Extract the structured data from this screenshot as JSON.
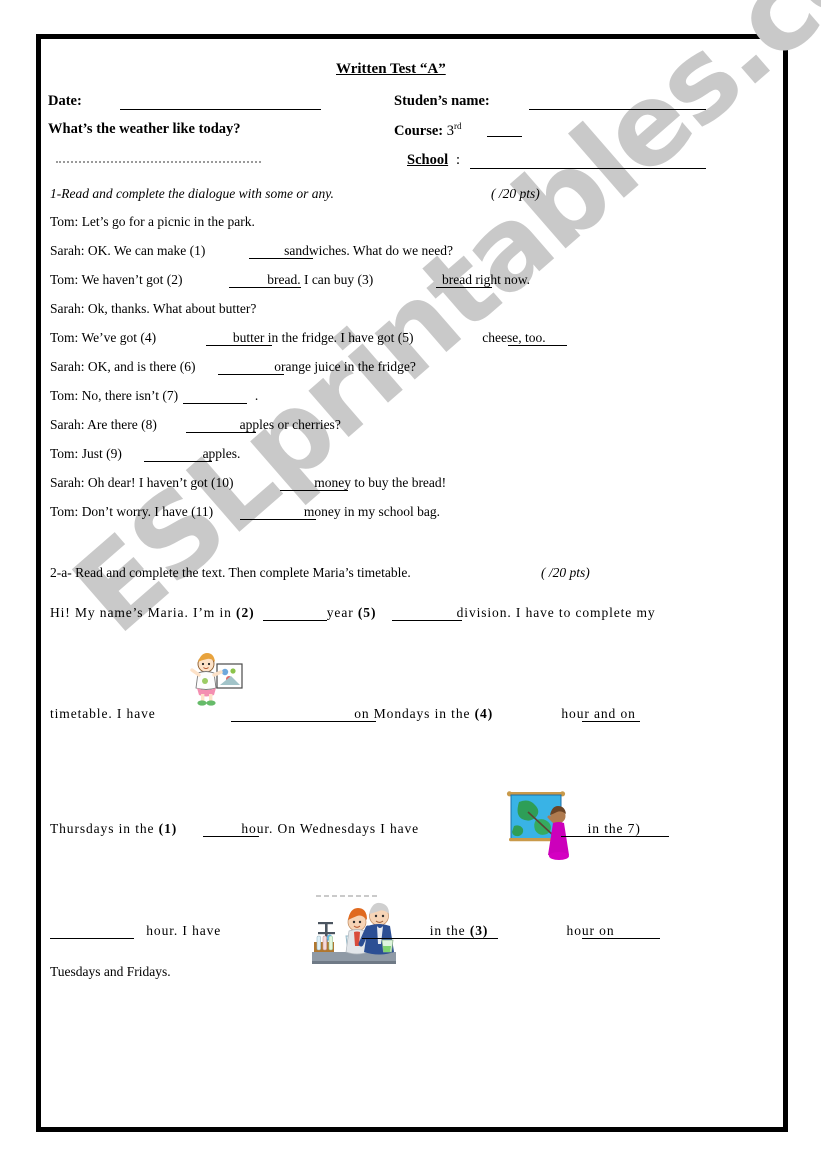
{
  "document": {
    "title": "Written Test “A”",
    "watermark": "ESLprintables.com"
  },
  "header": {
    "date_label": "Date:",
    "weather_question": "What’s the weather like today?",
    "student_name_label": "Studen’s name:",
    "course_label": "Course:",
    "course_value": "3",
    "course_ordinal": "rd",
    "school_label": "School",
    "school_colon": ":"
  },
  "exercise1": {
    "instruction": "1-Read and complete the dialogue with some or any.",
    "points": "(    /20 pts)",
    "lines": [
      {
        "speaker": "Tom:",
        "text": "Let’s go for a picnic in the park."
      },
      {
        "speaker": "Sarah:",
        "pre": "OK. We can make (1)",
        "post": "sandwiches. What do we need?"
      },
      {
        "speaker": "Tom:",
        "pre": "We haven’t got (2)",
        "mid": "bread. I can buy (3)",
        "post": "bread right now."
      },
      {
        "speaker": "Sarah:",
        "text": "Ok, thanks. What about butter?"
      },
      {
        "speaker": "Tom:",
        "pre": "We’ve got (4)",
        "mid": "butter in the fridge. I have got (5)",
        "post": "cheese, too."
      },
      {
        "speaker": "Sarah:",
        "pre": "OK, and is there (6)",
        "post": "orange juice in the fridge?"
      },
      {
        "speaker": "Tom:",
        "pre": "No, there isn’t (7)",
        "post": "."
      },
      {
        "speaker": "Sarah:",
        "pre": "Are there (8)",
        "post": "apples or cherries?"
      },
      {
        "speaker": "Tom:",
        "pre": "Just (9)",
        "post": "apples."
      },
      {
        "speaker": "Sarah:",
        "pre": "Oh dear! I haven’t got (10)",
        "post": "money to buy the bread!"
      },
      {
        "speaker": "Tom:",
        "pre": "Don’t worry. I have (11)",
        "post": "money in my school bag."
      }
    ]
  },
  "exercise2": {
    "instruction": "2-a- Read and complete the text. Then complete Maria’s timetable.",
    "points": "(    /20 pts)",
    "text_line1_a": "Hi!  My  name’s  Maria.  I’m  in",
    "text_line1_num1": "(2)",
    "text_line1_b": "year",
    "text_line1_num2": "(5)",
    "text_line1_c": "division.  I  have  to  complete  my",
    "text_line2_a": "timetable.  I  have",
    "text_line2_b": "on  Mondays  in  the",
    "text_line2_num": "(4)",
    "text_line2_c": "hour  and  on",
    "text_line3_a": "Thursdays  in  the",
    "text_line3_num": "(1)",
    "text_line3_b": "hour.  On  Wednesdays  I  have",
    "text_line3_c": "in  the  7)",
    "text_line4_a": "hour.  I  have",
    "text_line4_b": "in  the",
    "text_line4_num": "(3)",
    "text_line4_c": "hour  on",
    "text_line5": "Tuesdays and Fridays.",
    "clipart": [
      {
        "name": "art-class-child-clipart",
        "alt": "child holding a drawing"
      },
      {
        "name": "geography-map-pointer-clipart",
        "alt": "person pointing at world map"
      },
      {
        "name": "science-lab-experiment-clipart",
        "alt": "students doing a science experiment"
      }
    ]
  },
  "colors": {
    "border": "#000000",
    "text": "#000000",
    "watermark": "#c9c9c9",
    "dotted_rule": "#9a9a9a"
  }
}
